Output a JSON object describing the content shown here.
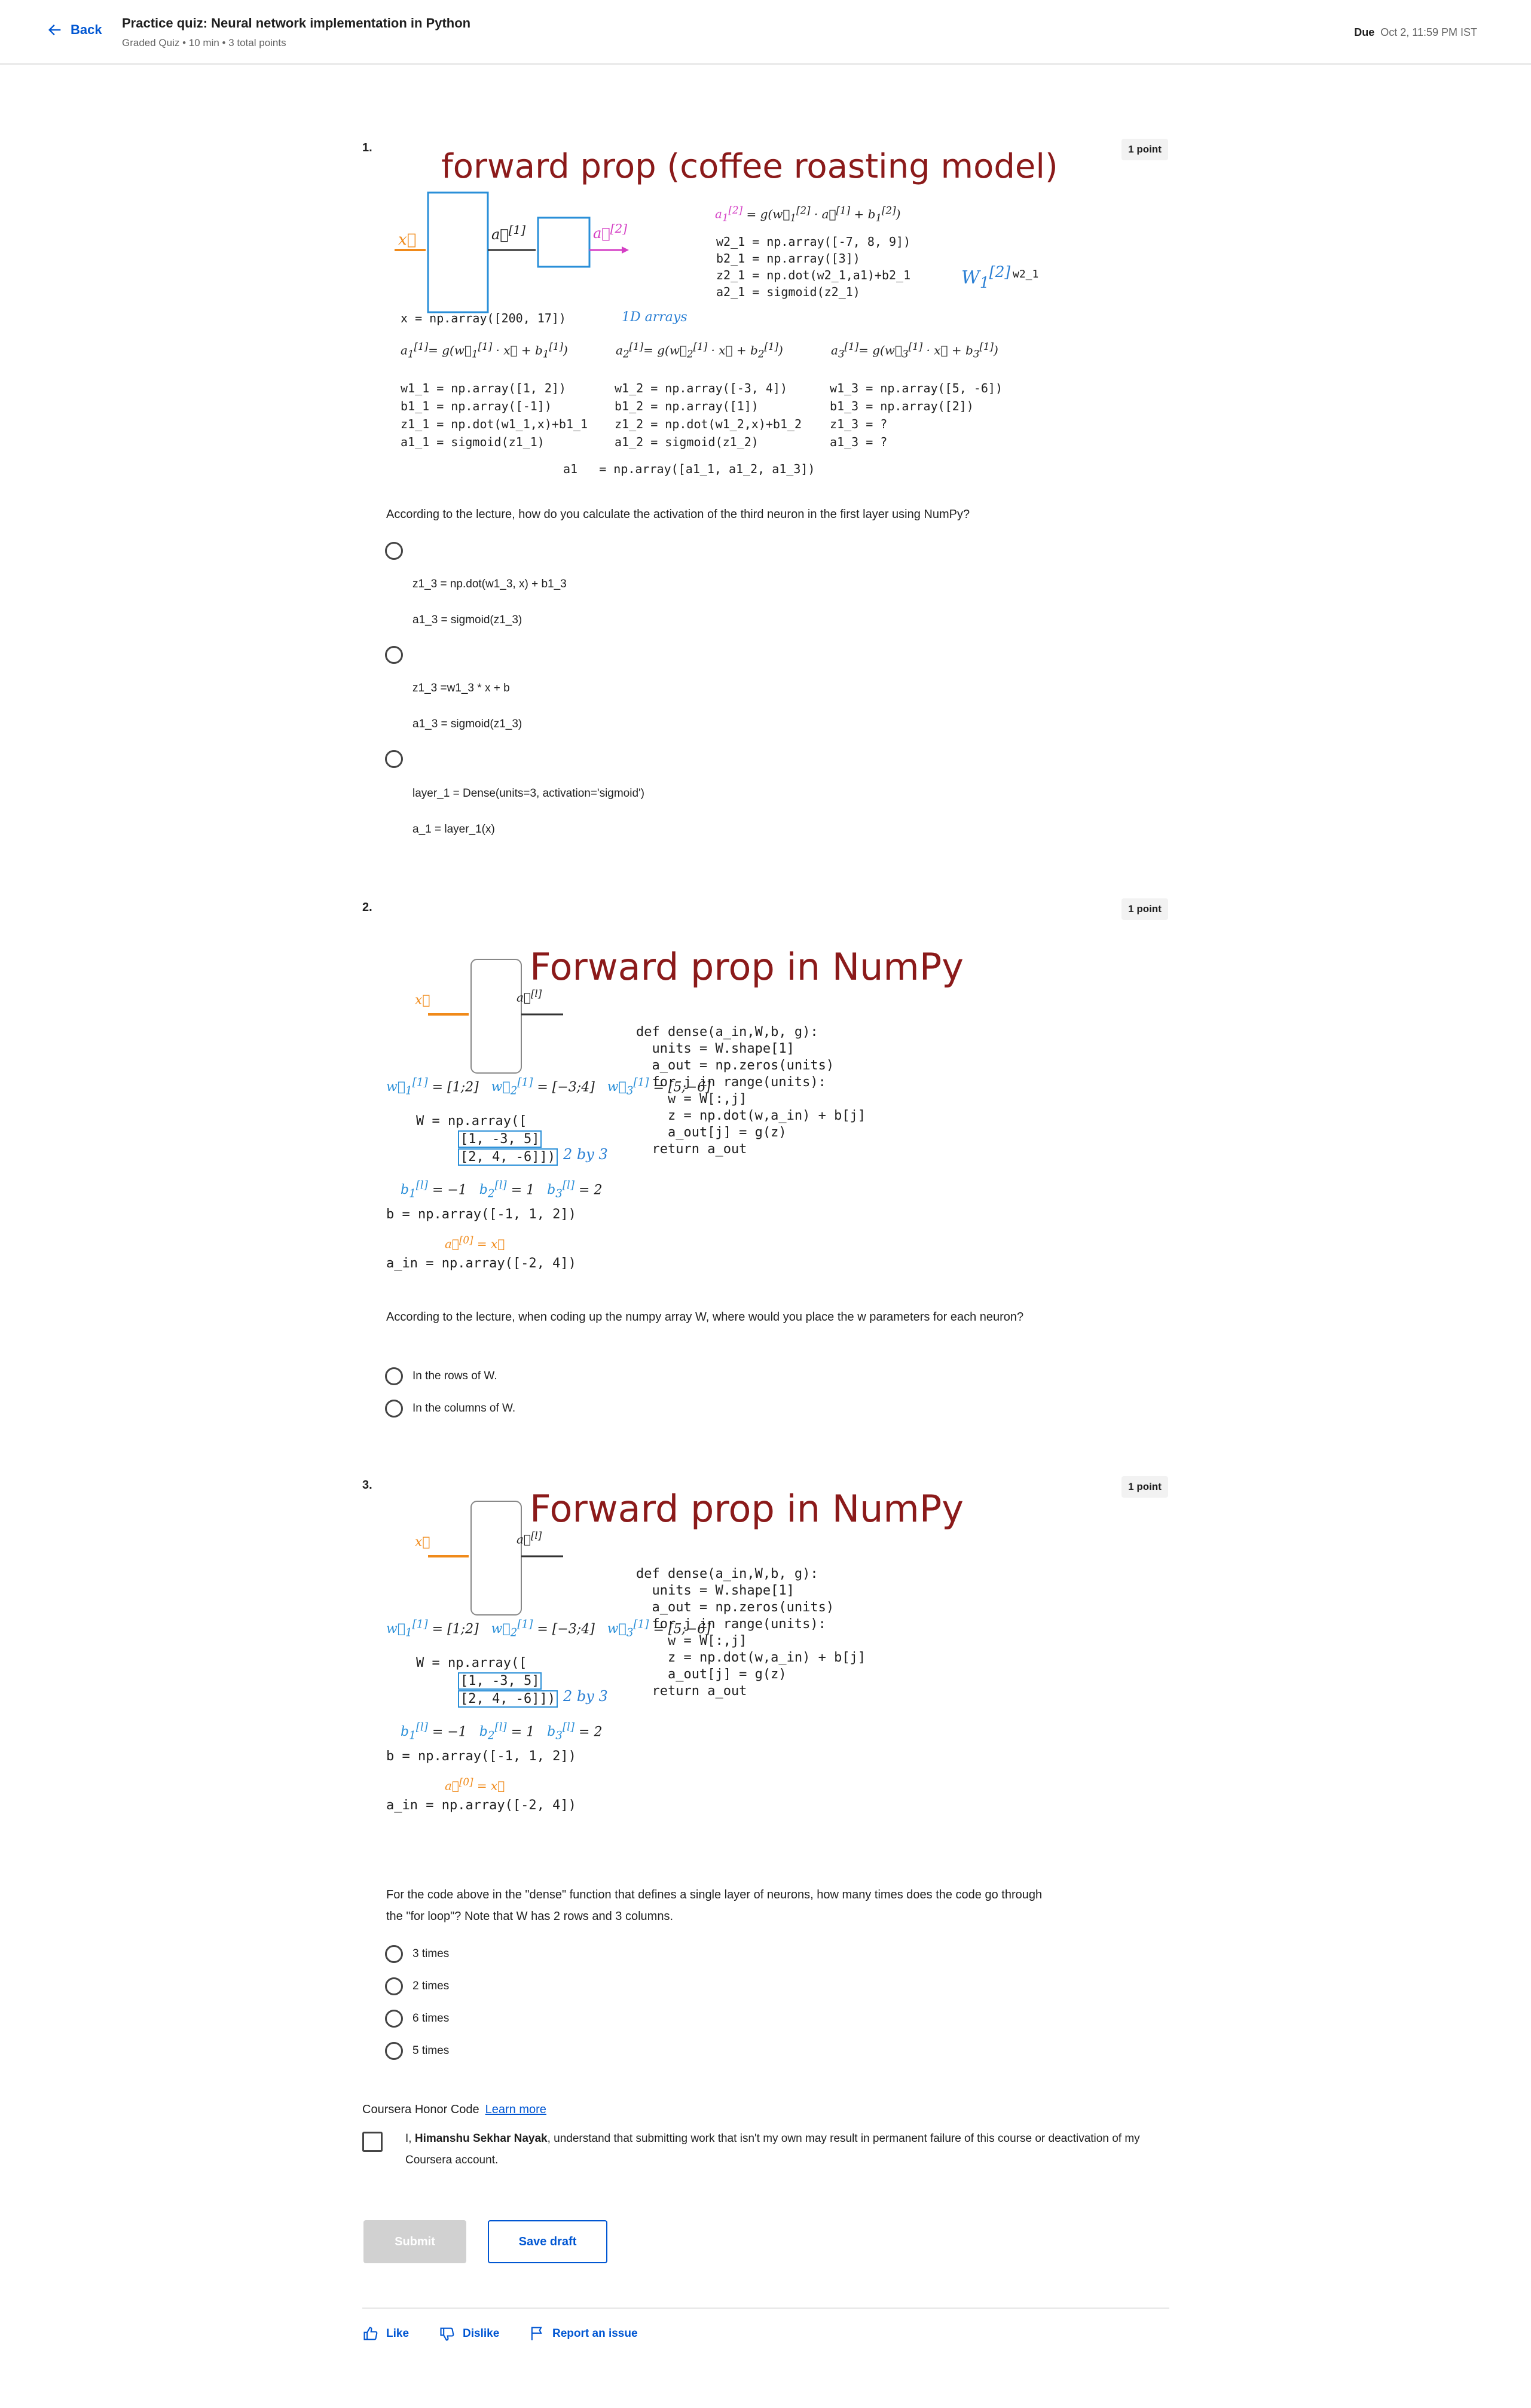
{
  "header": {
    "back_label": "Back",
    "title": "Practice quiz: Neural network implementation in Python",
    "meta": "Graded Quiz • 10 min • 3 total points",
    "due_label": "Due",
    "due_value": "Oct 2, 11:59 PM IST"
  },
  "questions": [
    {
      "number": "1.",
      "points": "1 point",
      "slide": {
        "title": "forward prop (coffee roasting model)",
        "top_code": "w2_1 = np.array([-7, 8, 9])\nb2_1 = np.array([3])\nz2_1 = np.dot(w2_1,a1)+b2_1\na2_1 = sigmoid(z2_1)",
        "x_code": "x = np.array([200, 17])",
        "arrays_note": "1D arrays",
        "col1": "w1_1 = np.array([1, 2])\nb1_1 = np.array([-1])\nz1_1 = np.dot(w1_1,x)+b1_1\na1_1 = sigmoid(z1_1)",
        "col2": "w1_2 = np.array([-3, 4])\nb1_2 = np.array([1])\nz1_2 = np.dot(w1_2,x)+b1_2\na1_2 = sigmoid(z1_2)",
        "col3": "w1_3 = np.array([5, -6])\nb1_3 = np.array([2])\nz1_3 = ?\na1_3 = ?",
        "a1_code": "a1   = np.array([a1_1, a1_2, a1_3])",
        "w2_1_note": "w2_1"
      },
      "text": "According to the lecture, how do you calculate the activation of the third neuron in the first layer using NumPy?",
      "options": [
        {
          "line1": "z1_3 = np.dot(w1_3, x) + b1_3",
          "line2": "a1_3 = sigmoid(z1_3)"
        },
        {
          "line1": "z1_3 =w1_3 * x + b",
          "line2": "a1_3 = sigmoid(z1_3)"
        },
        {
          "line1": "layer_1 = Dense(units=3, activation='sigmoid')",
          "line2": "a_1 = layer_1(x)"
        }
      ]
    },
    {
      "number": "2.",
      "points": "1 point",
      "slide": {
        "title": "Forward prop in NumPy",
        "dense_code": "def dense(a_in,W,b, g):\n  units = W.shape[1]\n  a_out = np.zeros(units)\n  for j in range(units):\n    w = W[:,j]\n    z = np.dot(w,a_in) + b[j]\n    a_out[j] = g(z)\n  return a_out",
        "W_code": "W = np.array([",
        "W_row1": "[1, -3, 5]",
        "W_row2": "[2, 4, -6]])",
        "by3": "2 by 3",
        "b_code": "b = np.array([-1, 1, 2])",
        "ain_code": "a_in = np.array([-2, 4])"
      },
      "text": "According to the lecture, when coding up the numpy array W, where would you place the w parameters for each neuron?",
      "options": [
        "In the rows of W.",
        "In the columns of W."
      ]
    },
    {
      "number": "3.",
      "points": "1 point",
      "text": "For the code above in the \"dense\" function that defines a single layer of neurons, how many times does the code go through the \"for loop\"? Note that W has 2 rows and 3 columns.",
      "options": [
        "3 times",
        "2 times",
        "6 times",
        "5 times"
      ]
    }
  ],
  "honor": {
    "heading": "Coursera Honor Code",
    "learn_more": "Learn more",
    "prefix": "I, ",
    "name": "Himanshu Sekhar Nayak",
    "suffix": ", understand that submitting work that isn't my own may result in permanent failure of this course or deactivation of my Coursera account."
  },
  "buttons": {
    "submit": "Submit",
    "save_draft": "Save draft"
  },
  "footer": {
    "like": "Like",
    "dislike": "Dislike",
    "report": "Report an issue"
  },
  "colors": {
    "accent": "#0056d2",
    "slide_title": "#8b1a1a",
    "handwriting": "#2a7fd4"
  }
}
